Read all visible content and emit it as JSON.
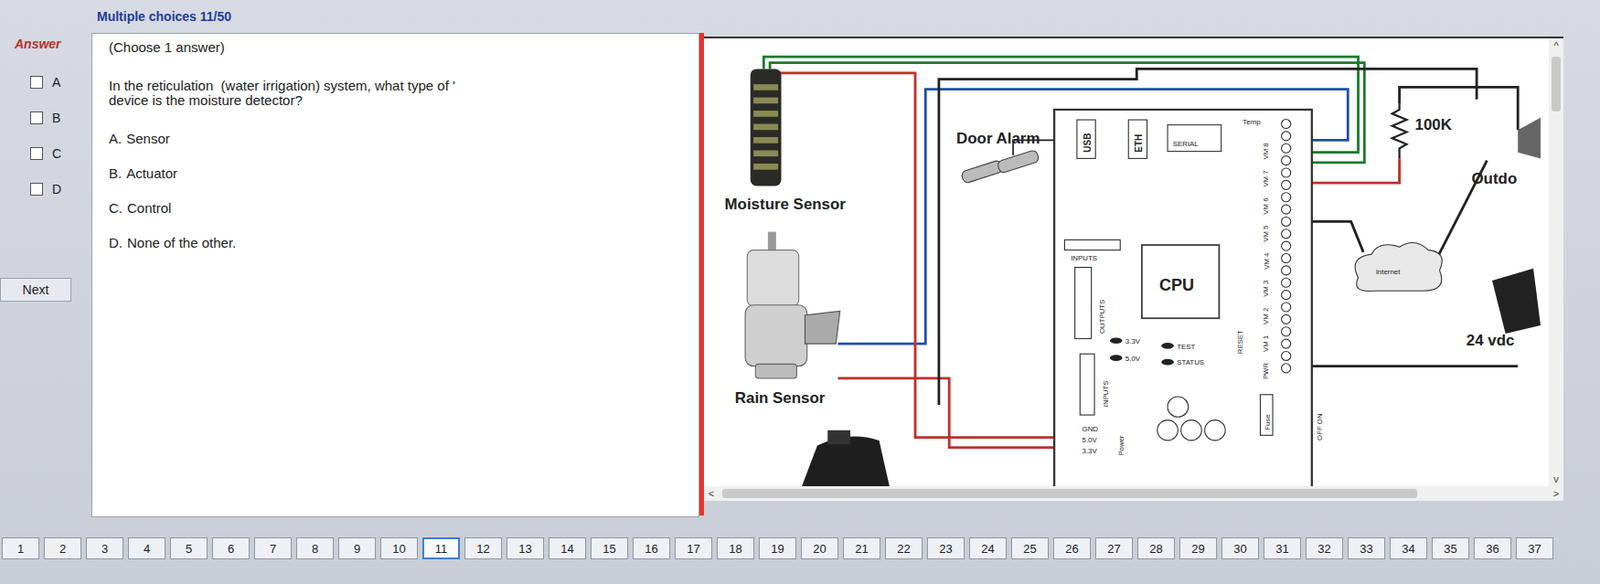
{
  "header": {
    "title": "Multiple choices 11/50"
  },
  "answer_panel": {
    "label": "Answer",
    "choices": [
      {
        "letter": "A",
        "checked": false
      },
      {
        "letter": "B",
        "checked": false
      },
      {
        "letter": "C",
        "checked": false
      },
      {
        "letter": "D",
        "checked": false
      }
    ]
  },
  "next_button": "Next",
  "question": {
    "instruction": "(Choose 1 answer)",
    "lines": [
      "In the reticulation  (water irrigation) system, what type of '",
      "device is the moisture detector?"
    ],
    "options": [
      {
        "letter": "A.",
        "text": "Sensor"
      },
      {
        "letter": "B.",
        "text": "Actuator"
      },
      {
        "letter": "C.",
        "text": "Control"
      },
      {
        "letter": "D.",
        "text": "None of the other."
      }
    ]
  },
  "diagram": {
    "moisture": "Moisture Sensor",
    "rain": "Rain Sensor",
    "door": "Door Alarm",
    "board": {
      "usb": "USB",
      "eth": "ETH",
      "serial": "SERIAL",
      "temp": "Temp",
      "inputs_top": "INPUTS",
      "outputs": "OUTPUTS",
      "inputs": "INPUTS",
      "cpu": "CPU",
      "leds": [
        "3.3V",
        "5.0V",
        "TEST",
        "STATUS"
      ],
      "reset": "RESET",
      "power_pins": [
        "GND",
        "5.0V",
        "3.3V"
      ],
      "power": "Power",
      "fuse": "Fuse",
      "switch": "OFF ON",
      "terminals": [
        "PWR",
        "VM 1",
        "VM 2",
        "VM 3",
        "VM 4",
        "VM 5",
        "VM 6",
        "VM 7",
        "VM 8"
      ]
    },
    "resistor": "100K",
    "outdoor": "Outdo",
    "cloud": "Internet",
    "supply": "24 vdc"
  },
  "scroll": {
    "left": "<",
    "right": ">",
    "up": "^",
    "down": "v"
  },
  "pagination": [
    {
      "label": "1",
      "selected": false
    },
    {
      "label": "2",
      "selected": false
    },
    {
      "label": "3",
      "selected": false
    },
    {
      "label": "4",
      "selected": false
    },
    {
      "label": "5",
      "selected": false
    },
    {
      "label": "6",
      "selected": false
    },
    {
      "label": "7",
      "selected": false
    },
    {
      "label": "8",
      "selected": false
    },
    {
      "label": "9",
      "selected": false
    },
    {
      "label": "10",
      "selected": false
    },
    {
      "label": "11",
      "selected": true
    },
    {
      "label": "12",
      "selected": false
    },
    {
      "label": "13",
      "selected": false
    },
    {
      "label": "14",
      "selected": false
    },
    {
      "label": "15",
      "selected": false
    },
    {
      "label": "16",
      "selected": false
    },
    {
      "label": "17",
      "selected": false
    },
    {
      "label": "18",
      "selected": false
    },
    {
      "label": "19",
      "selected": false
    },
    {
      "label": "20",
      "selected": false
    },
    {
      "label": "21",
      "selected": false
    },
    {
      "label": "22",
      "selected": false
    },
    {
      "label": "23",
      "selected": false
    },
    {
      "label": "24",
      "selected": false
    },
    {
      "label": "25",
      "selected": false
    },
    {
      "label": "26",
      "selected": false
    },
    {
      "label": "27",
      "selected": false
    },
    {
      "label": "28",
      "selected": false
    },
    {
      "label": "29",
      "selected": false
    },
    {
      "label": "30",
      "selected": false
    },
    {
      "label": "31",
      "selected": false
    },
    {
      "label": "32",
      "selected": false
    },
    {
      "label": "33",
      "selected": false
    },
    {
      "label": "34",
      "selected": false
    },
    {
      "label": "35",
      "selected": false
    },
    {
      "label": "36",
      "selected": false
    },
    {
      "label": "37",
      "selected": false
    }
  ]
}
